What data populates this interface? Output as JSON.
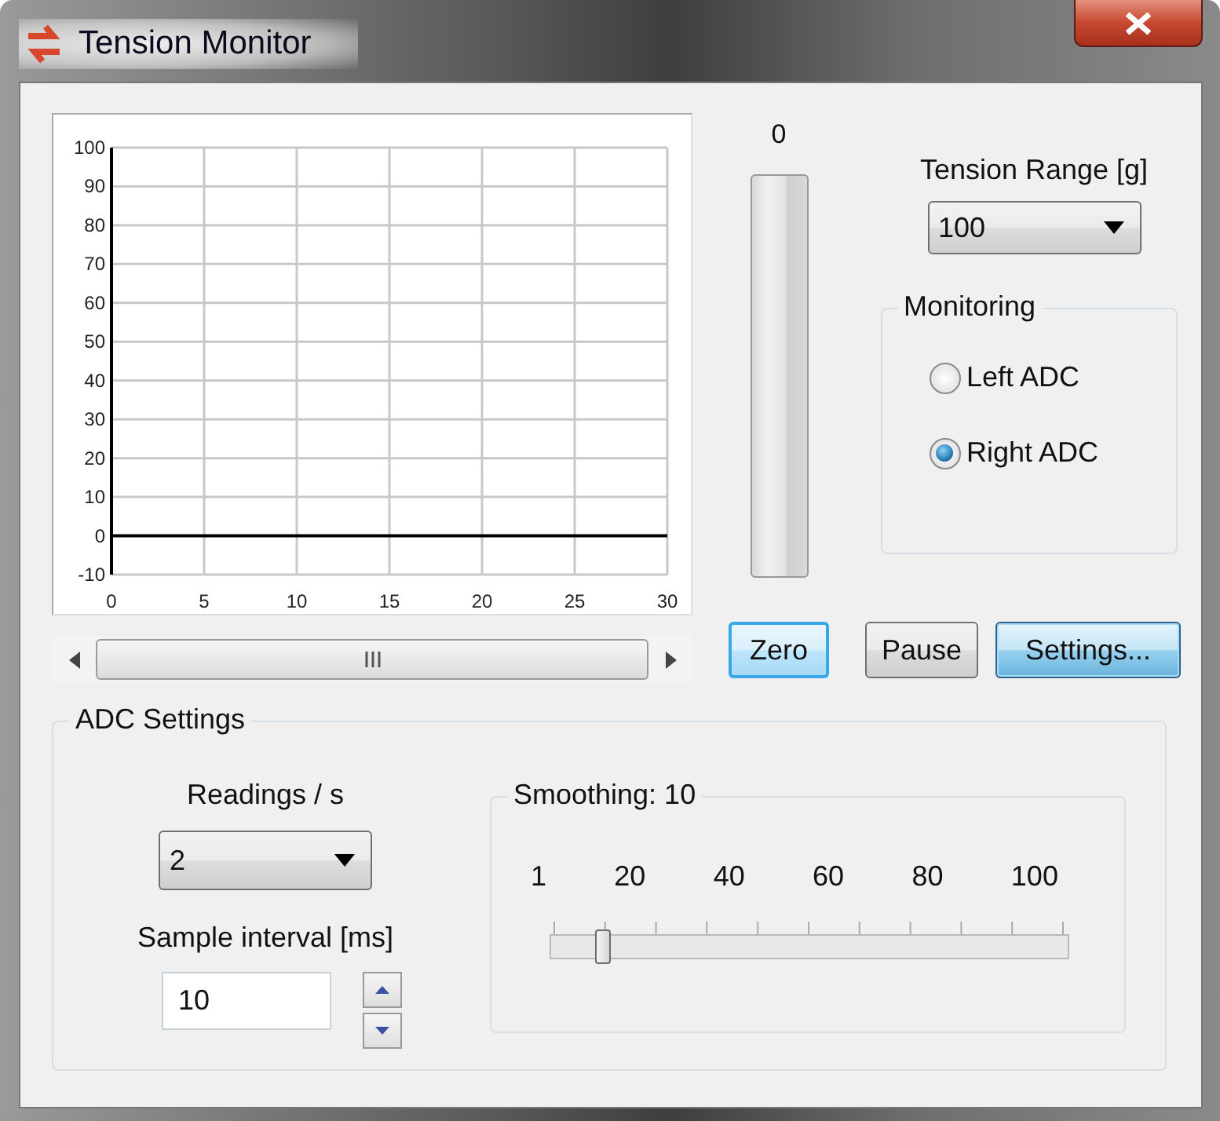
{
  "window": {
    "title": "Tension Monitor"
  },
  "chart": {
    "chart_data": {
      "type": "line",
      "grid": true,
      "xlim": [
        0,
        30
      ],
      "ylim": [
        -10,
        100
      ],
      "xticks": [
        0,
        5,
        10,
        15,
        20,
        25,
        30
      ],
      "yticks": [
        -10,
        0,
        10,
        20,
        30,
        40,
        50,
        60,
        70,
        80,
        90,
        100
      ]
    }
  },
  "meter": {
    "reading": "0",
    "level": 0
  },
  "tension_range": {
    "label": "Tension Range [g]",
    "value": "100"
  },
  "monitoring": {
    "title": "Monitoring",
    "options": [
      {
        "label": "Left ADC",
        "selected": false
      },
      {
        "label": "Right ADC",
        "selected": true
      }
    ]
  },
  "buttons": [
    {
      "label": "Zero",
      "kind": "focused"
    },
    {
      "label": "Pause",
      "kind": "normal"
    },
    {
      "label": "Settings...",
      "kind": "default"
    }
  ],
  "adc_settings": {
    "title": "ADC Settings",
    "readings_label": "Readings / s",
    "readings_value": "2",
    "interval_label": "Sample interval [ms]",
    "interval_value": "10",
    "smoothing": {
      "title": "Smoothing: 10",
      "scale": [
        "1",
        "20",
        "40",
        "60",
        "80",
        "100"
      ],
      "level": 0.1
    }
  }
}
